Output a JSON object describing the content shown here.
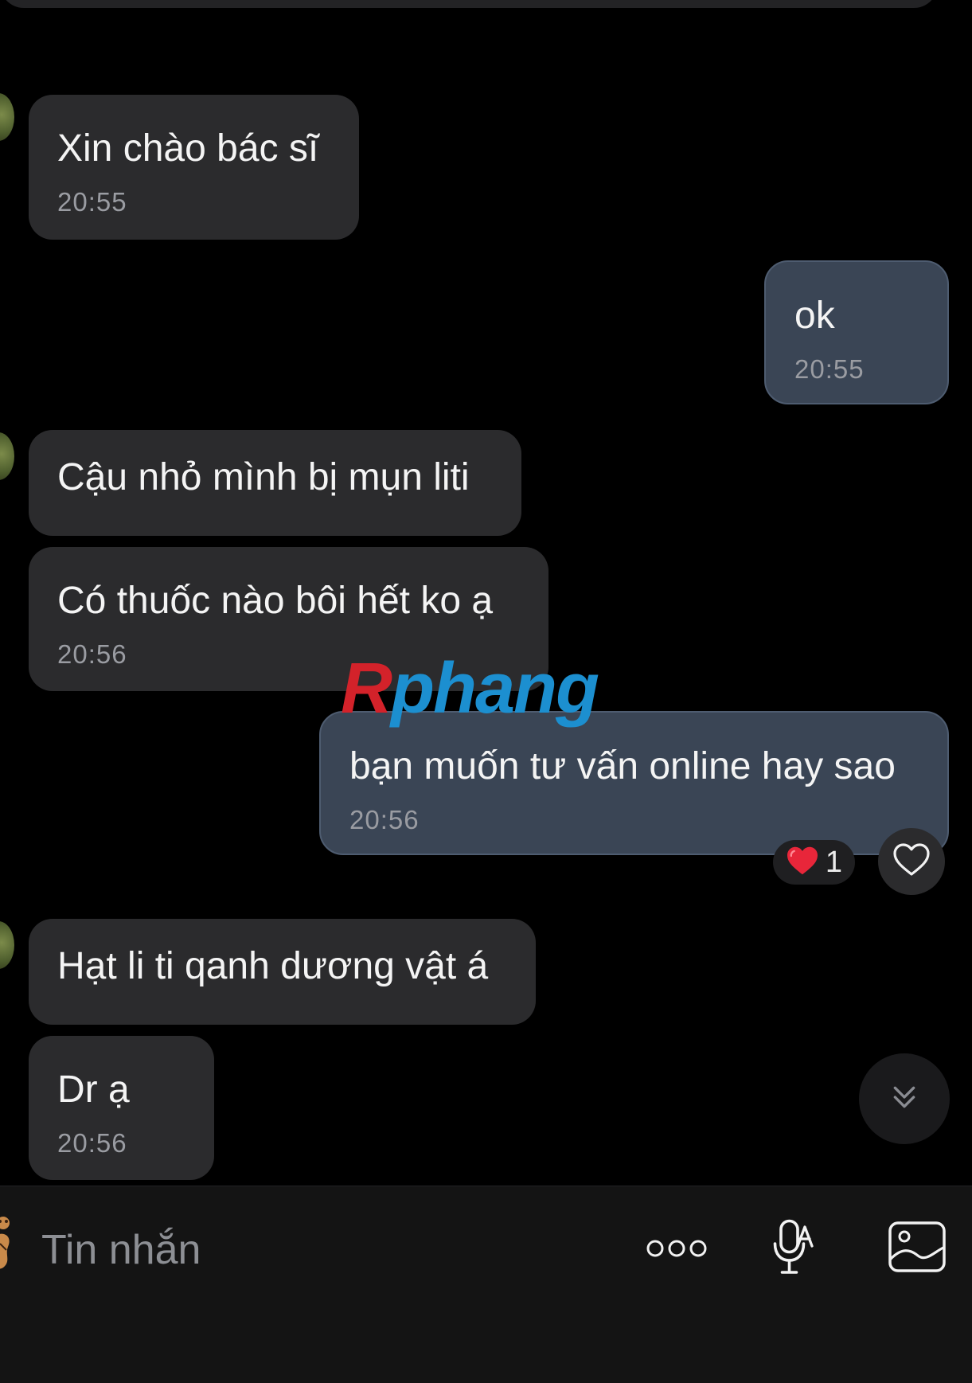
{
  "messages": [
    {
      "id": "m1",
      "direction": "incoming",
      "text": "Xin chào bác sĩ",
      "time": "20:55"
    },
    {
      "id": "m2",
      "direction": "outgoing",
      "text": "ok",
      "time": "20:55"
    },
    {
      "id": "m3",
      "direction": "incoming",
      "text": "Cậu nhỏ mình bị mụn liti",
      "time": ""
    },
    {
      "id": "m4",
      "direction": "incoming",
      "text": "Có thuốc nào bôi hết ko ạ",
      "time": "20:56"
    },
    {
      "id": "m5",
      "direction": "outgoing",
      "text": "bạn muốn tư vấn online hay sao",
      "time": "20:56"
    },
    {
      "id": "m6",
      "direction": "incoming",
      "text": "Hạt li ti qanh dương vật á",
      "time": ""
    },
    {
      "id": "m7",
      "direction": "incoming",
      "text": "Dr ạ",
      "time": "20:56"
    }
  ],
  "reaction": {
    "emoji": "heart",
    "count": "1"
  },
  "watermark": {
    "first": "R",
    "rest": "phang"
  },
  "composer": {
    "placeholder": "Tin nhắn"
  },
  "icons": {
    "react": "heart-outline-icon",
    "scroll": "double-chevron-down-icon",
    "more": "more-dots-icon",
    "voice": "voice-to-text-mic-icon",
    "image": "image-gallery-icon",
    "sticker": "sticker-icon"
  },
  "colors": {
    "background": "#000000",
    "incoming_bubble": "#2b2b2d",
    "outgoing_bubble": "#3a4555",
    "time_text": "#9a9ca2",
    "heart_red": "#e8263a",
    "watermark_red": "#d3222a",
    "watermark_blue": "#1c8fd0"
  }
}
